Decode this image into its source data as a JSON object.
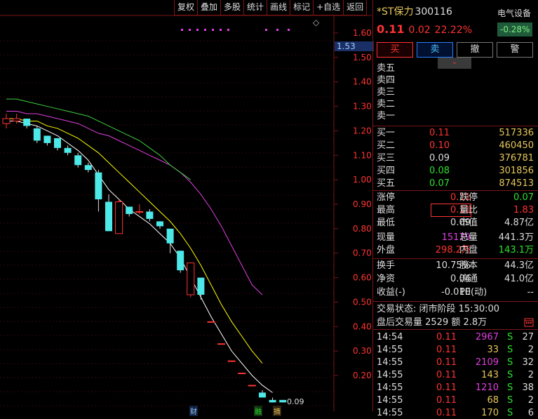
{
  "toolbar": {
    "items": [
      "复权",
      "叠加",
      "多股",
      "统计",
      "画线",
      "标记",
      "+自选",
      "返回"
    ]
  },
  "chart": {
    "diamond": "◇",
    "current_tag": "1.53",
    "last_price_label": "0.09",
    "y_ticks": [
      "1.60",
      "1.50",
      "1.40",
      "1.30",
      "1.20",
      "1.10",
      "1.00",
      "0.90",
      "0.80",
      "0.70",
      "0.60",
      "0.50",
      "0.40",
      "0.30",
      "0.20"
    ],
    "bottom_tags": [
      "财",
      "融",
      "摘"
    ]
  },
  "chart_data": {
    "type": "candlestick",
    "y_axis": {
      "min": 0.1,
      "max": 1.6,
      "ticks": [
        1.6,
        1.5,
        1.4,
        1.3,
        1.2,
        1.1,
        1.0,
        0.9,
        0.8,
        0.7,
        0.6,
        0.5,
        0.4,
        0.3,
        0.2
      ]
    },
    "candles": [
      {
        "o": 1.23,
        "c": 1.25,
        "h": 1.27,
        "l": 1.21
      },
      {
        "o": 1.24,
        "c": 1.25,
        "h": 1.27,
        "l": 1.23
      },
      {
        "o": 1.25,
        "c": 1.22,
        "h": 1.25,
        "l": 1.21
      },
      {
        "o": 1.21,
        "c": 1.16,
        "h": 1.22,
        "l": 1.15
      },
      {
        "o": 1.18,
        "c": 1.15,
        "h": 1.18,
        "l": 1.14
      },
      {
        "o": 1.17,
        "c": 1.13,
        "h": 1.17,
        "l": 1.12
      },
      {
        "o": 1.13,
        "c": 1.11,
        "h": 1.14,
        "l": 1.1
      },
      {
        "o": 1.1,
        "c": 1.06,
        "h": 1.11,
        "l": 1.05
      },
      {
        "o": 1.06,
        "c": 1.04,
        "h": 1.07,
        "l": 1.03
      },
      {
        "o": 1.03,
        "c": 0.92,
        "h": 1.04,
        "l": 0.87
      },
      {
        "o": 0.91,
        "c": 0.79,
        "h": 0.94,
        "l": 0.79
      },
      {
        "o": 0.78,
        "c": 0.91,
        "h": 0.92,
        "l": 0.78
      },
      {
        "o": 0.89,
        "c": 0.86,
        "h": 0.89,
        "l": 0.85
      },
      {
        "o": 0.87,
        "c": 0.87,
        "h": 0.9,
        "l": 0.86
      },
      {
        "o": 0.87,
        "c": 0.84,
        "h": 0.88,
        "l": 0.83
      },
      {
        "o": 0.83,
        "c": 0.81,
        "h": 0.83,
        "l": 0.8
      },
      {
        "o": 0.8,
        "c": 0.74,
        "h": 0.8,
        "l": 0.7
      },
      {
        "o": 0.71,
        "c": 0.63,
        "h": 0.71,
        "l": 0.62
      },
      {
        "o": 0.53,
        "c": 0.66,
        "h": 0.66,
        "l": 0.52
      },
      {
        "o": 0.6,
        "c": 0.53,
        "h": 0.6,
        "l": 0.51
      },
      {
        "o": 0.42,
        "c": 0.42,
        "h": 0.42,
        "l": 0.42
      },
      {
        "o": 0.33,
        "c": 0.33,
        "h": 0.33,
        "l": 0.33
      },
      {
        "o": 0.26,
        "c": 0.26,
        "h": 0.26,
        "l": 0.26
      },
      {
        "o": 0.21,
        "c": 0.21,
        "h": 0.21,
        "l": 0.21
      },
      {
        "o": 0.16,
        "c": 0.16,
        "h": 0.16,
        "l": 0.16
      },
      {
        "o": 0.13,
        "c": 0.11,
        "h": 0.14,
        "l": 0.11
      },
      {
        "o": 0.1,
        "c": 0.09,
        "h": 0.11,
        "l": 0.09
      },
      {
        "o": 0.1,
        "c": 0.09,
        "h": 0.1,
        "l": 0.09
      }
    ],
    "ma_lines": [
      {
        "color": "#ffffff",
        "values": [
          1.24,
          1.24,
          1.23,
          1.22,
          1.2,
          1.18,
          1.15,
          1.12,
          1.08,
          1.02,
          0.96,
          0.92,
          0.88,
          0.85,
          0.82,
          0.78,
          0.74,
          0.68,
          0.6,
          0.52,
          0.44,
          0.37,
          0.3,
          0.25,
          0.2,
          0.16,
          0.13
        ]
      },
      {
        "color": "#ffff00",
        "values": [
          1.25,
          1.25,
          1.24,
          1.24,
          1.22,
          1.21,
          1.19,
          1.17,
          1.14,
          1.11,
          1.07,
          1.03,
          0.99,
          0.95,
          0.91,
          0.87,
          0.83,
          0.78,
          0.72,
          0.65,
          0.57,
          0.49,
          0.42,
          0.36,
          0.3,
          0.25
        ]
      },
      {
        "color": "#e040e0",
        "values": [
          1.28,
          1.28,
          1.27,
          1.27,
          1.26,
          1.25,
          1.24,
          1.23,
          1.21,
          1.19,
          1.18,
          1.16,
          1.14,
          1.12,
          1.1,
          1.08,
          1.06,
          1.03,
          0.99,
          0.94,
          0.88,
          0.81,
          0.73,
          0.65,
          0.57,
          0.53
        ]
      },
      {
        "color": "#3ecf3e",
        "values": [
          1.33,
          1.33,
          1.32,
          1.31,
          1.3,
          1.29,
          1.28,
          1.27,
          1.26,
          1.24,
          1.22,
          1.2,
          1.18,
          1.16,
          1.13,
          1.1,
          1.06,
          1.03,
          1.0
        ]
      }
    ]
  },
  "quote": {
    "name": "*ST保力",
    "code": "300116",
    "price": "0.11",
    "change": "0.02",
    "change_pct": "22.22%",
    "sector": "电气设备",
    "sector_chg": "-0.28%"
  },
  "actions": {
    "buy": "买",
    "sell": "卖",
    "cancel": "撤",
    "alert": "警"
  },
  "expander": "⌄",
  "asks": [
    {
      "label": "卖五",
      "price": "",
      "vol": ""
    },
    {
      "label": "卖四",
      "price": "",
      "vol": ""
    },
    {
      "label": "卖三",
      "price": "",
      "vol": ""
    },
    {
      "label": "卖二",
      "price": "",
      "vol": ""
    },
    {
      "label": "卖一",
      "price": "",
      "vol": ""
    }
  ],
  "bids": [
    {
      "label": "买一",
      "price": "0.11",
      "vol": "517336"
    },
    {
      "label": "买二",
      "price": "0.10",
      "vol": "460450"
    },
    {
      "label": "买三",
      "price": "0.09",
      "vol": "376781"
    },
    {
      "label": "买四",
      "price": "0.08",
      "vol": "301856"
    },
    {
      "label": "买五",
      "price": "0.07",
      "vol": "874513"
    }
  ],
  "stats": {
    "zt_l": "涨停",
    "zt_v": "0.11",
    "dt_l": "跌停",
    "dt_v": "0.07",
    "gao_l": "最高",
    "gao_v": "0.11",
    "lb_l": "量比",
    "lb_v": "1.83",
    "di_l": "最低",
    "di_v": "0.09",
    "sz_l": "市值",
    "sz_v": "4.87亿",
    "xl_l": "现量",
    "xl_v": "15179",
    "zl_l": "总量",
    "zl_v": "441.3万",
    "wp_l": "外盘",
    "wp_v": "298.2万",
    "np_l": "内盘",
    "np_v": "143.1万",
    "hs_l": "换手",
    "hs_v": "10.75%",
    "gb_l": "股本",
    "gb_v": "44.3亿",
    "jz_l": "净资",
    "jz_v": "0.04",
    "lt_l": "流通",
    "lt_v": "41.0亿",
    "sy_l": "收益(-)",
    "sy_v": "-0.010",
    "pe_l": "PE(动)",
    "pe_v": "--"
  },
  "status": {
    "line1": "交易状态: 闭市阶段 15:30:00",
    "line2": "盘后交易量 2529 额 2.8万"
  },
  "ticks": [
    {
      "time": "14:54",
      "price": "0.11",
      "vol": "2967",
      "dir": "S",
      "n": "27",
      "volc": "mag"
    },
    {
      "time": "14:55",
      "price": "0.11",
      "vol": "33",
      "dir": "S",
      "n": "2",
      "volc": "yel"
    },
    {
      "time": "14:55",
      "price": "0.11",
      "vol": "2109",
      "dir": "S",
      "n": "32",
      "volc": "mag"
    },
    {
      "time": "14:55",
      "price": "0.11",
      "vol": "143",
      "dir": "S",
      "n": "2",
      "volc": "yel"
    },
    {
      "time": "14:55",
      "price": "0.11",
      "vol": "1210",
      "dir": "S",
      "n": "38",
      "volc": "mag"
    },
    {
      "time": "14:55",
      "price": "0.11",
      "vol": "68",
      "dir": "S",
      "n": "2",
      "volc": "yel"
    },
    {
      "time": "14:55",
      "price": "0.11",
      "vol": "170",
      "dir": "S",
      "n": "6",
      "volc": "yel"
    }
  ]
}
